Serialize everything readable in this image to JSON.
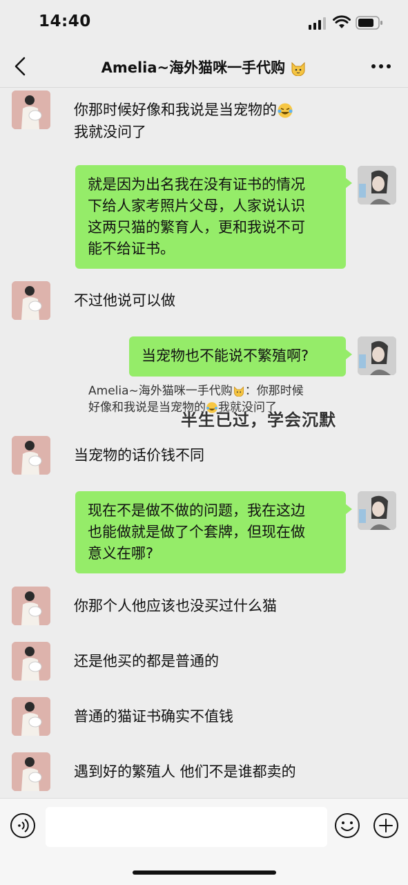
{
  "status_bar": {
    "time": "14:40"
  },
  "header": {
    "title": "Amelia~海外猫咪一手代购",
    "back_icon": "chevron-left-icon",
    "more_icon": "more-dots-icon"
  },
  "messages": [
    {
      "from": "friend",
      "lines": [
        "你那时候好像和我说是当宠物的",
        "我就没问了"
      ]
    },
    {
      "from": "me",
      "lines": [
        "就是因为出名我在没有证书的情况",
        "下给人家考照片父母，人家说认识",
        "这两只猫的繁育人，更和我说不可",
        "能不给证书。"
      ]
    },
    {
      "from": "friend",
      "lines": [
        "不过他说可以做"
      ]
    },
    {
      "from": "me",
      "lines": [
        "当宠物也不能说不繁殖啊?"
      ]
    },
    {
      "from": "friend",
      "lines": [
        "当宠物的话价钱不同"
      ]
    },
    {
      "from": "me",
      "lines": [
        "现在不是做不做的问题，我在这边",
        "也能做就是做了个套牌，但现在做",
        "意义在哪?"
      ]
    },
    {
      "from": "friend",
      "lines": [
        "你那个人他应该也没买过什么猫"
      ]
    },
    {
      "from": "friend",
      "lines": [
        "还是他买的都是普通的"
      ]
    },
    {
      "from": "friend",
      "lines": [
        "普通的猫证书确实不值钱"
      ]
    },
    {
      "from": "friend",
      "lines": [
        "遇到好的繁殖人 他们不是谁都卖的"
      ]
    }
  ],
  "quote": {
    "line1": "Amelia~海外猫咪一手代购",
    "line1_suffix": "：你那时候",
    "line2": "好像和我说是当宠物的",
    "line2_suffix": "我就没问了"
  },
  "overlay_text": "半生已过，学会沉默",
  "input_bar": {
    "placeholder": "",
    "voice_icon": "voice-icon",
    "emoji_icon": "smiley-icon",
    "plus_icon": "plus-icon"
  },
  "colors": {
    "background": "#ededed",
    "my_bubble": "#95ec69",
    "friend_avatar_bg": "#ddb3ac"
  }
}
